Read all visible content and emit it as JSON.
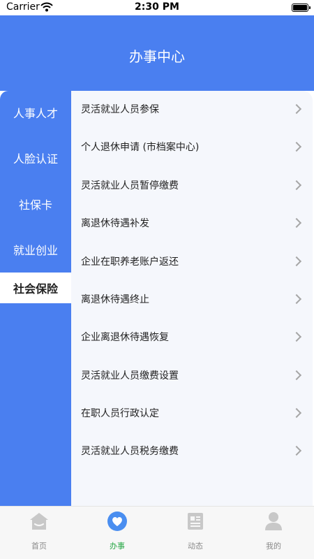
{
  "status_bar": {
    "carrier": "Carrier",
    "time": "2:30 PM"
  },
  "header": {
    "title": "办事中心",
    "background_color": "#4a7ff0"
  },
  "sidebar": {
    "items": [
      {
        "label": "人事人才",
        "active": false
      },
      {
        "label": "人脸认证",
        "active": false
      },
      {
        "label": "社保卡",
        "active": false
      },
      {
        "label": "就业创业",
        "active": false
      },
      {
        "label": "社会保险",
        "active": true
      }
    ]
  },
  "services": [
    {
      "label": "灵活就业人员参保"
    },
    {
      "label": "个人退休申请 (市档案中心)"
    },
    {
      "label": "灵活就业人员暂停缴费"
    },
    {
      "label": "离退休待遇补发"
    },
    {
      "label": "企业在职养老账户返还"
    },
    {
      "label": "离退休待遇终止"
    },
    {
      "label": "企业离退休待遇恢复"
    },
    {
      "label": "灵活就业人员缴费设置"
    },
    {
      "label": "在职人员行政认定"
    },
    {
      "label": "灵活就业人员税务缴费"
    }
  ],
  "tabbar": {
    "items": [
      {
        "label": "首页",
        "icon": "home-icon",
        "active": false
      },
      {
        "label": "办事",
        "icon": "heart-icon",
        "active": true
      },
      {
        "label": "动态",
        "icon": "news-icon",
        "active": false
      },
      {
        "label": "我的",
        "icon": "profile-icon",
        "active": false
      }
    ],
    "active_color": "#27a745",
    "inactive_color": "#c8c8c8"
  }
}
